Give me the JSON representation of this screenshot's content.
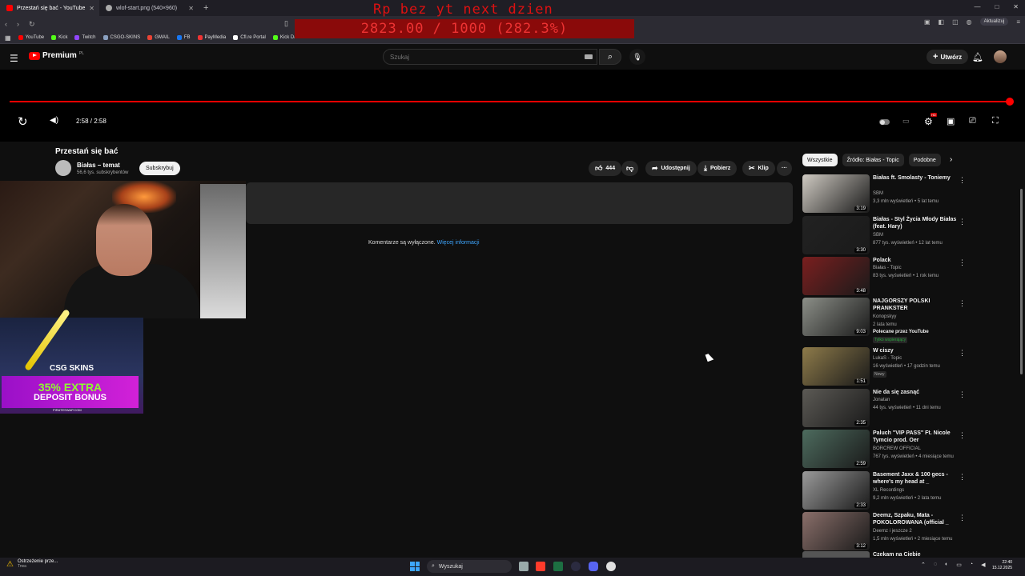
{
  "browser": {
    "tabs": [
      {
        "label": "Przestań się bać - YouTube",
        "active": true,
        "favicon_color": "#ff0000"
      },
      {
        "label": "wlof-start.png (540×960)",
        "active": false,
        "favicon_color": "#aaaaaa"
      }
    ],
    "update_label": "Aktualizuj",
    "bookmarks": [
      {
        "label": "YouTube",
        "color": "#ff0000"
      },
      {
        "label": "Kick",
        "color": "#53fc18"
      },
      {
        "label": "Twitch",
        "color": "#9146ff"
      },
      {
        "label": "CSGO-SKINS",
        "color": "#8aa0c0"
      },
      {
        "label": "GMAIL",
        "color": "#ea4335"
      },
      {
        "label": "FB",
        "color": "#1877f2"
      },
      {
        "label": "PayMedia",
        "color": "#e33"
      },
      {
        "label": "Cfl.re Portal",
        "color": "#ffffff"
      },
      {
        "label": "Kick Dashboard",
        "color": "#53fc18"
      }
    ]
  },
  "stream_overlay": {
    "line1": "Rp bez yt next dzien",
    "line2": "2823.00 / 1000 (282.3%)"
  },
  "youtube": {
    "logo_text": "Premium",
    "logo_region": "PL",
    "search_placeholder": "Szukaj",
    "create_label": "Utwórz",
    "colors": {
      "accent": "#ff0000",
      "bg": "#0f0f0f",
      "link": "#3ea6ff"
    }
  },
  "player": {
    "time": "2:58 / 2:58",
    "progress": 1.0,
    "quality_badge": "HD"
  },
  "video": {
    "title": "Przestań się bać",
    "channel": "Białas – temat",
    "subscribers": "56,6 tys. subskrybentów",
    "subscribe_label": "Subskrybuj",
    "likes": "444",
    "share_label": "Udostępnij",
    "download_label": "Pobierz",
    "clip_label": "Klip",
    "comments_off": "Komentarze są wyłączone.",
    "more_info": "Więcej informacji"
  },
  "ad": {
    "logo": "CSG SKINS",
    "line1": "35% EXTRA",
    "line2": "DEPOSIT BONUS",
    "site": "PIRATESWAP.COM"
  },
  "sidebar": {
    "chips": [
      "Wszystkie",
      "Źródło: Białas - Topic",
      "Podobne"
    ],
    "recommendations": [
      {
        "title": "Białas ft. Smolasty - Toniemy",
        "channel": "SBM",
        "meta": "3,3 mln wyświetleń • 5 lat temu",
        "duration": "3:19",
        "thumb": "#cfcac2"
      },
      {
        "title": "Białas - Styl Życia Młody Białas (feat. Hary)",
        "channel": "SBM",
        "meta": "877 tys. wyświetleń • 12 lat temu",
        "duration": "3:30",
        "thumb": "#222222"
      },
      {
        "title": "Polack",
        "channel": "Białas - Topic",
        "meta": "83 tys. wyświetleń • 1 rok temu",
        "duration": "3:48",
        "thumb": "#7a1f1f"
      },
      {
        "title": "NAJGORSZY POLSKI PRANKSTER",
        "channel": "Konopskyy",
        "meta": "2 lata temu",
        "extra": "Polecane przez YouTube",
        "badge": "Tylko wspierający",
        "duration": "9:03",
        "thumb": "#8c8f88"
      },
      {
        "title": "W ciszy",
        "channel": "LukaS - Topic",
        "meta": "16 wyświetleń • 17 godzin temu",
        "badge": "Nowy",
        "duration": "1:51",
        "thumb": "#8e7b4a"
      },
      {
        "title": "Nie da się zasnąć",
        "channel": "Jonatan",
        "meta": "44 tys. wyświetleń • 11 dni temu",
        "duration": "2:35",
        "thumb": "#5c5a55"
      },
      {
        "title": "Paluch \"VIP PASS\" Ft. Nicole Tymcio prod. Oer",
        "channel": "BORCREW OFFICIAL",
        "meta": "767 tys. wyświetleń • 4 miesiące temu",
        "duration": "2:59",
        "thumb": "#4d6b5e"
      },
      {
        "title": "Basement Jaxx & 100 gecs - where's my head at _",
        "channel": "XL Recordings",
        "meta": "9,2 mln wyświetleń • 2 lata temu",
        "duration": "2:33",
        "thumb": "#9a9a9a"
      },
      {
        "title": "Deemz, Szpaku, Mata - POKOLOROWANA (official _",
        "channel": "Deemz",
        "channel_extra": "i jeszcze 2",
        "meta": "1,5 mln wyświetleń • 2 miesiące temu",
        "duration": "3:12",
        "thumb": "#8a6f6a"
      }
    ],
    "partial_title": "Czekam na Ciebie"
  },
  "taskbar": {
    "notice_title": "Ostrzeżenie prze...",
    "notice_sub": "Trwa",
    "search_label": "Wyszukaj",
    "time": "22:40",
    "date": "15.12.2025"
  }
}
